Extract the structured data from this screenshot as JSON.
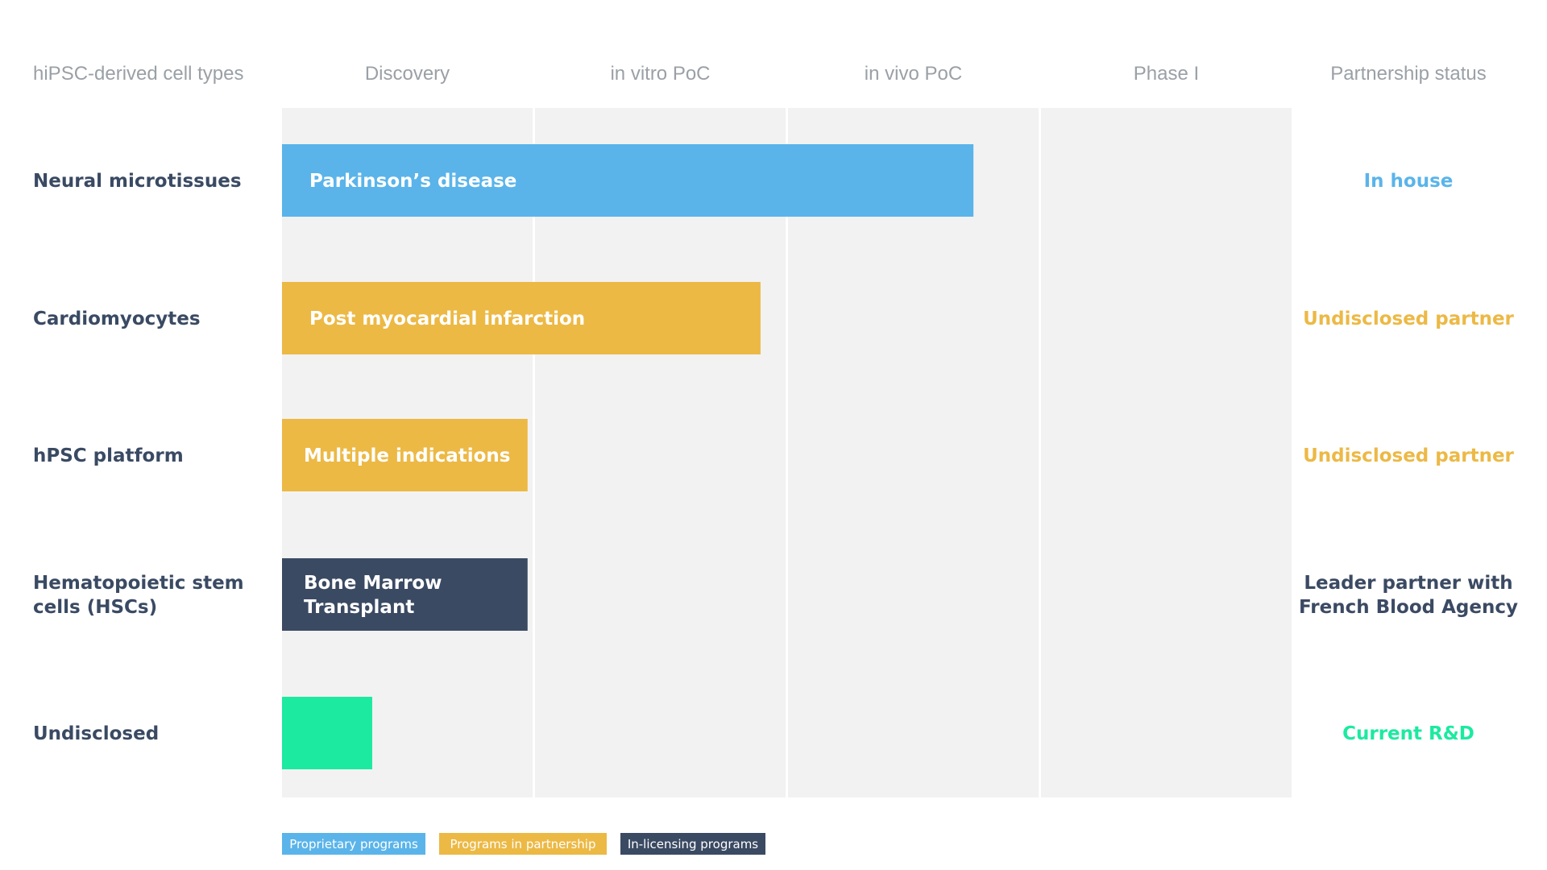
{
  "chart_data": {
    "type": "bar",
    "orientation": "horizontal",
    "title": "",
    "stages": [
      "Discovery",
      "in vitro PoC",
      "in vivo PoC",
      "Phase I"
    ],
    "headers": {
      "first_column": "hiPSC-derived cell types",
      "last_column": "Partnership status"
    },
    "rows": [
      {
        "cell_type": [
          "Neural microtissues"
        ],
        "program": [
          "Parkinson’s disease"
        ],
        "progress": 2.74,
        "category": "proprietary",
        "status": [
          "In house"
        ],
        "status_category": "proprietary"
      },
      {
        "cell_type": [
          "Cardiomyocytes"
        ],
        "program": [
          "Post myocardial infarction"
        ],
        "progress": 1.9,
        "category": "partnership",
        "status": [
          "Undisclosed partner"
        ],
        "status_category": "partnership"
      },
      {
        "cell_type": [
          "hPSC platform"
        ],
        "program": [
          "Multiple indications"
        ],
        "progress": 0.98,
        "category": "partnership",
        "status": [
          "Undisclosed partner"
        ],
        "status_category": "partnership"
      },
      {
        "cell_type": [
          "Hematopoietic stem",
          "cells (HSCs)"
        ],
        "program": [
          "Bone Marrow",
          "Transplant"
        ],
        "progress": 0.98,
        "category": "in_licensing",
        "status": [
          "Leader partner with",
          "French Blood Agency"
        ],
        "status_category": "in_licensing"
      },
      {
        "cell_type": [
          "Undisclosed"
        ],
        "program": [],
        "progress": 0.36,
        "category": "rnd",
        "status": [
          "Current R&D"
        ],
        "status_category": "rnd"
      }
    ],
    "legend": [
      {
        "label": "Proprietary programs",
        "category": "proprietary"
      },
      {
        "label": "Programs in partnership",
        "category": "partnership"
      },
      {
        "label": "In-licensing programs",
        "category": "in_licensing"
      }
    ],
    "colors": {
      "proprietary": "#5ab4ea",
      "partnership": "#ecb945",
      "in_licensing": "#3b4a63",
      "rnd": "#1beaa0",
      "background": "#f2f2f2",
      "header_text": "#9aa0a6",
      "label_text": "#3a4a63"
    }
  }
}
